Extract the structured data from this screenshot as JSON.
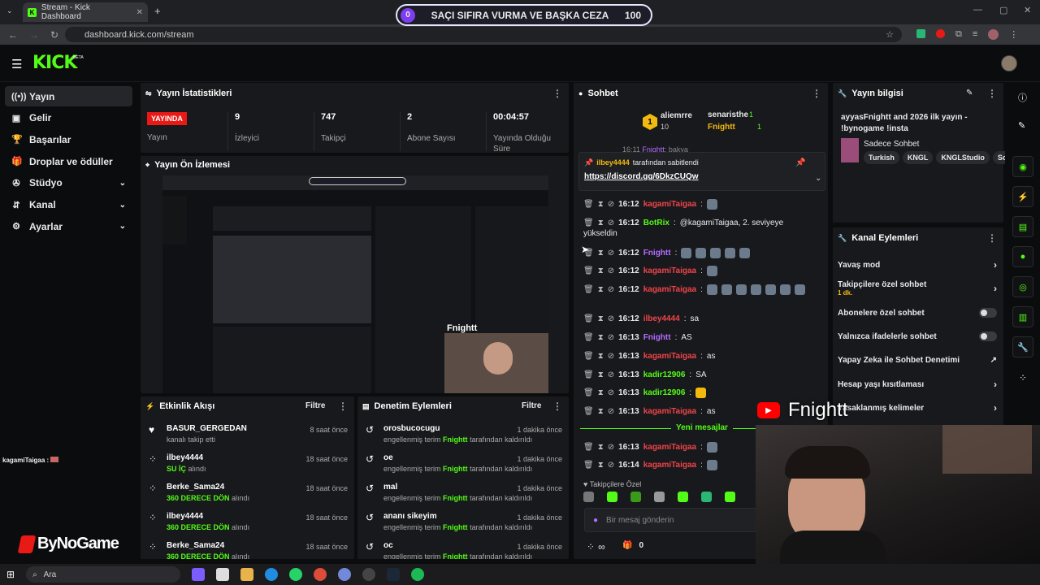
{
  "browser": {
    "tab_title": "Stream - Kick Dashboard",
    "url": "dashboard.kick.com/stream"
  },
  "banner": {
    "left": "0",
    "text": "SAÇI SIFIRA VURMA VE BAŞKA CEZA",
    "right": "100"
  },
  "kick": {
    "logo": "KICK",
    "beta": "BETA"
  },
  "sidebar": [
    {
      "label": "Yayın",
      "icon": "broadcast-icon",
      "active": true
    },
    {
      "label": "Gelir",
      "icon": "money-icon"
    },
    {
      "label": "Başarılar",
      "icon": "trophy-icon"
    },
    {
      "label": "Droplar ve ödüller",
      "icon": "gift-icon"
    },
    {
      "label": "Stüdyo",
      "icon": "studio-icon",
      "chevron": true
    },
    {
      "label": "Kanal",
      "icon": "channel-icon",
      "chevron": true
    },
    {
      "label": "Ayarlar",
      "icon": "gear-icon",
      "chevron": true
    }
  ],
  "stats": {
    "title": "Yayın İstatistikleri",
    "live_badge": "YAYINDA",
    "live_label": "Yayın",
    "items": [
      {
        "value": "9",
        "label": "İzleyici"
      },
      {
        "value": "747",
        "label": "Takipçi"
      },
      {
        "value": "2",
        "label": "Abone Sayısı"
      },
      {
        "value": "00:04:57",
        "label": "Yayında Olduğu Süre"
      }
    ]
  },
  "preview": {
    "title": "Yayın Ön İzlemesi",
    "watermark": "Fnightt"
  },
  "activity": {
    "title": "Etkinlik Akışı",
    "filter": "Filtre",
    "items": [
      {
        "name": "BASUR_GERGEDAN",
        "sub": "kanalı takip etti",
        "highlight": "",
        "time": "8 saat önce",
        "icon": "heart-icon"
      },
      {
        "name": "ilbey4444",
        "sub": "alındı",
        "highlight": "SU İÇ",
        "time": "18 saat önce",
        "icon": "points-icon"
      },
      {
        "name": "Berke_Sama24",
        "sub": "alındı",
        "highlight": "360 DERECE DÖN",
        "time": "18 saat önce",
        "icon": "points-icon"
      },
      {
        "name": "ilbey4444",
        "sub": "alındı",
        "highlight": "360 DERECE DÖN",
        "time": "18 saat önce",
        "icon": "points-icon"
      },
      {
        "name": "Berke_Sama24",
        "sub": "alındı",
        "highlight": "360 DERECE DÖN",
        "time": "18 saat önce",
        "icon": "points-icon"
      }
    ]
  },
  "moderation": {
    "title": "Denetim Eylemleri",
    "filter": "Filtre",
    "items": [
      {
        "term": "orosbucocugu",
        "time": "1 dakika önce"
      },
      {
        "term": "oe",
        "time": "1 dakika önce"
      },
      {
        "term": "mal",
        "time": "1 dakika önce"
      },
      {
        "term": "ananı sikeyim",
        "time": "1 dakika önce"
      },
      {
        "term": "oc",
        "time": "1 dakika önce"
      }
    ],
    "pre": "engellenmiş terim",
    "by": "Fnightt",
    "post": "tarafından kaldırıldı"
  },
  "chat": {
    "title": "Sohbet",
    "top": {
      "rank1": "1",
      "user1": "aliemrre",
      "count1": "10",
      "user2": "senaristhe",
      "count2": "1",
      "user3": "Fnightt",
      "count3": "1"
    },
    "pinned": {
      "user": "ilbey4444",
      "text": "tarafından sabitlendi",
      "link": "https://discord.gg/6DkzCUQw",
      "faded_time": "16:11",
      "faded_user": "Fnightt",
      "faded_msg": "bakya"
    },
    "messages": [
      {
        "time": "16:12",
        "user": "kagamiTaigaa",
        "color": "#f0444a",
        "msg": ""
      },
      {
        "time": "16:12",
        "user": "BotRix",
        "color": "#53fc18",
        "msg": "@kagamiTaigaa, 2. seviyeye",
        "msg2": "yükseldin"
      },
      {
        "time": "16:12",
        "user": "Fnightt",
        "color": "#b36dff",
        "msg": ""
      },
      {
        "time": "16:12",
        "user": "kagamiTaigaa",
        "color": "#f0444a",
        "msg": ""
      },
      {
        "time": "16:12",
        "user": "kagamiTaigaa",
        "color": "#f0444a",
        "msg": ""
      },
      {
        "time": "16:12",
        "user": "ilbey4444",
        "color": "#f0444a",
        "msg": "sa"
      },
      {
        "time": "16:13",
        "user": "Fnightt",
        "color": "#b36dff",
        "msg": "AS"
      },
      {
        "time": "16:13",
        "user": "kagamiTaigaa",
        "color": "#f0444a",
        "msg": "as"
      },
      {
        "time": "16:13",
        "user": "kadir12906",
        "color": "#53fc18",
        "msg": "SA"
      },
      {
        "time": "16:13",
        "user": "kadir12906",
        "color": "#53fc18",
        "msg": ""
      },
      {
        "time": "16:13",
        "user": "kagamiTaigaa",
        "color": "#f0444a",
        "msg": "as"
      },
      {
        "time": "16:13",
        "user": "kagamiTaigaa",
        "color": "#f0444a",
        "msg": ""
      },
      {
        "time": "16:14",
        "user": "kagamiTaigaa",
        "color": "#f0444a",
        "msg": ""
      }
    ],
    "new_messages": "Yeni mesajlar",
    "followers_only": "Takipçilere Özel",
    "input_placeholder": "Bir mesaj gönderin",
    "points": "0",
    "infinite": "∞"
  },
  "stream_info": {
    "title_label": "Yayın bilgisi",
    "title": "ayyasFnightt and 2026 ilk yayın - !bynogame !insta",
    "category": "Sadece Sohbet",
    "tags": [
      "Turkish",
      "KNGL",
      "KNGLStudio",
      "So"
    ]
  },
  "channel_actions": {
    "title": "Kanal Eylemleri",
    "items": [
      {
        "label": "Yavaş mod",
        "type": "chevron"
      },
      {
        "label": "Takipçilere özel sohbet",
        "sub": "1 dk.",
        "type": "chevron"
      },
      {
        "label": "Abonelere özel sohbet",
        "type": "toggle"
      },
      {
        "label": "Yalnızca ifadelerle sohbet",
        "type": "toggle"
      },
      {
        "label": "Yapay Zeka ile Sohbet Denetimi",
        "type": "external"
      },
      {
        "label": "Hesap yaşı kısıtlaması",
        "type": "chevron"
      },
      {
        "label": "Yasaklanmış kelimeler",
        "type": "chevron"
      }
    ]
  },
  "overlay": {
    "channel": "Fnightt",
    "left_chat_user": "kagamiTaigaa :",
    "sponsor": "ByNoGame"
  },
  "taskbar": {
    "search": "Ara"
  },
  "colors": {
    "accent": "#53fc18",
    "panel": "#18191c",
    "live": "#e91916"
  }
}
